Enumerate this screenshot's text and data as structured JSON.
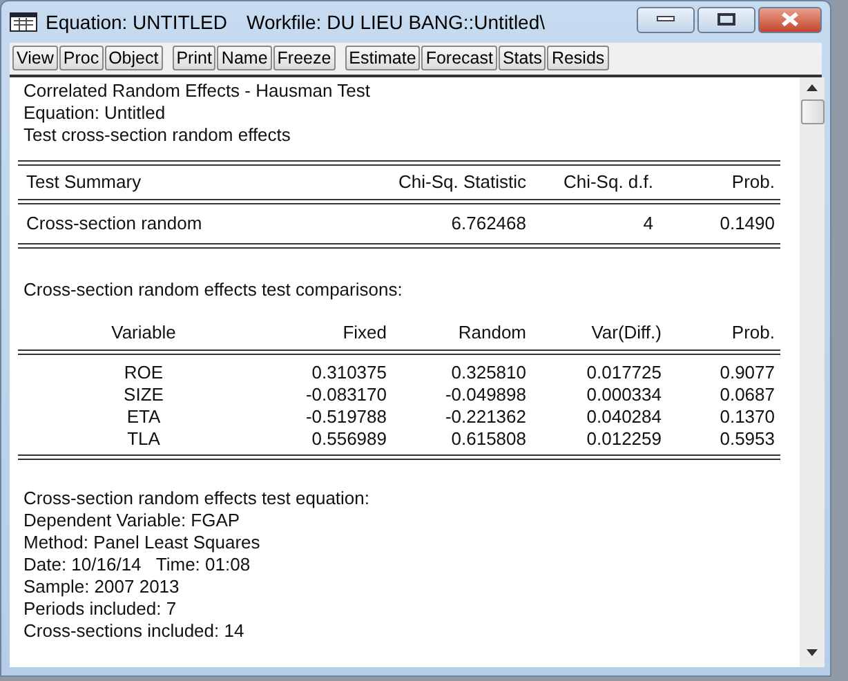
{
  "window": {
    "title": "Equation: UNTITLED",
    "workfile": "Workfile: DU LIEU BANG::Untitled\\"
  },
  "toolbar": [
    [
      "View",
      "Proc",
      "Object"
    ],
    [
      "Print",
      "Name",
      "Freeze"
    ],
    [
      "Estimate",
      "Forecast",
      "Stats",
      "Resids"
    ]
  ],
  "header_lines": [
    "Correlated Random Effects - Hausman Test",
    "Equation: Untitled",
    "Test cross-section random effects"
  ],
  "summary_table": {
    "columns": [
      "Test Summary",
      "Chi-Sq. Statistic",
      "Chi-Sq. d.f.",
      "Prob."
    ],
    "rows": [
      [
        "Cross-section random",
        "6.762468",
        "4",
        "0.1490"
      ]
    ]
  },
  "comparisons_title": "Cross-section random effects test comparisons:",
  "comparisons_table": {
    "columns": [
      "Variable",
      "Fixed",
      "Random",
      "Var(Diff.)",
      "Prob."
    ],
    "rows": [
      [
        "ROE",
        "0.310375",
        "0.325810",
        "0.017725",
        "0.9077"
      ],
      [
        "SIZE",
        "-0.083170",
        "-0.049898",
        "0.000334",
        "0.0687"
      ],
      [
        "ETA",
        "-0.519788",
        "-0.221362",
        "0.040284",
        "0.1370"
      ],
      [
        "TLA",
        "0.556989",
        "0.615808",
        "0.012259",
        "0.5953"
      ]
    ]
  },
  "equation_lines": [
    "Cross-section random effects test equation:",
    "Dependent Variable: FGAP",
    "Method: Panel Least Squares",
    "Date: 10/16/14   Time: 01:08",
    "Sample: 2007 2013",
    "Periods included: 7",
    "Cross-sections included: 14"
  ]
}
